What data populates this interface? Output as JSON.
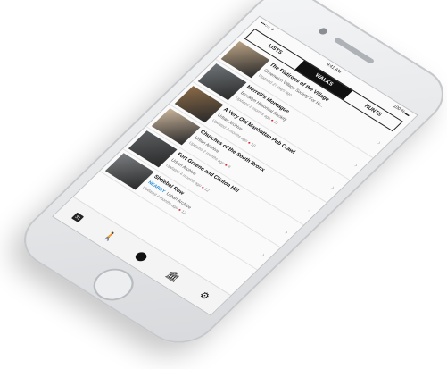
{
  "status": {
    "left": "•••○○ ✦",
    "time": "9:41 AM",
    "battery": "100 % ▬"
  },
  "tabs": [
    {
      "label": "LISTS",
      "active": false
    },
    {
      "label": "WALKS",
      "active": true
    },
    {
      "label": "HUNTS",
      "active": false
    }
  ],
  "items": [
    {
      "title": "The Flatirons of the Village",
      "subtitle": "Greenwich Village Society For Hi...",
      "meta": "Updated 27 days ago",
      "count": "",
      "thumb": "#b9a183"
    },
    {
      "title": "Merrell's Montague",
      "subtitle": "Brooklyn Historical Society",
      "meta": "Updated 2 months ago",
      "count": "11",
      "thumb": "#6f7478"
    },
    {
      "title": "A Very Old Manhattan Pub Crawl",
      "subtitle": "Urban Archive",
      "meta": "Updated 2 months ago",
      "count": "10",
      "thumb": "#8a6a47"
    },
    {
      "title": "Churches of the South Bronx",
      "subtitle": "Urban Archive",
      "meta": "Updated 2 months ago",
      "count": "8",
      "thumb": "#c8b39a"
    },
    {
      "title": "Fort Greene and Clinton Hill",
      "subtitle": "Urban Archive",
      "meta": "Updated 4 months ago",
      "count": "12",
      "thumb": "#5b5e61"
    },
    {
      "title": "Shtiebel Row",
      "subtitle": "Urban Archive",
      "meta": "Updated 4 months ago",
      "count": "12",
      "thumb": "#7a7d80",
      "nearby": "NEARBY"
    }
  ],
  "toolbar": {
    "calendar_label": "31",
    "icons": [
      "walks-icon",
      "map-pin-icon",
      "museum-icon",
      "settings-icon"
    ]
  },
  "colors": {
    "accent": "#2a8fd6",
    "pin": "#dd2233"
  }
}
